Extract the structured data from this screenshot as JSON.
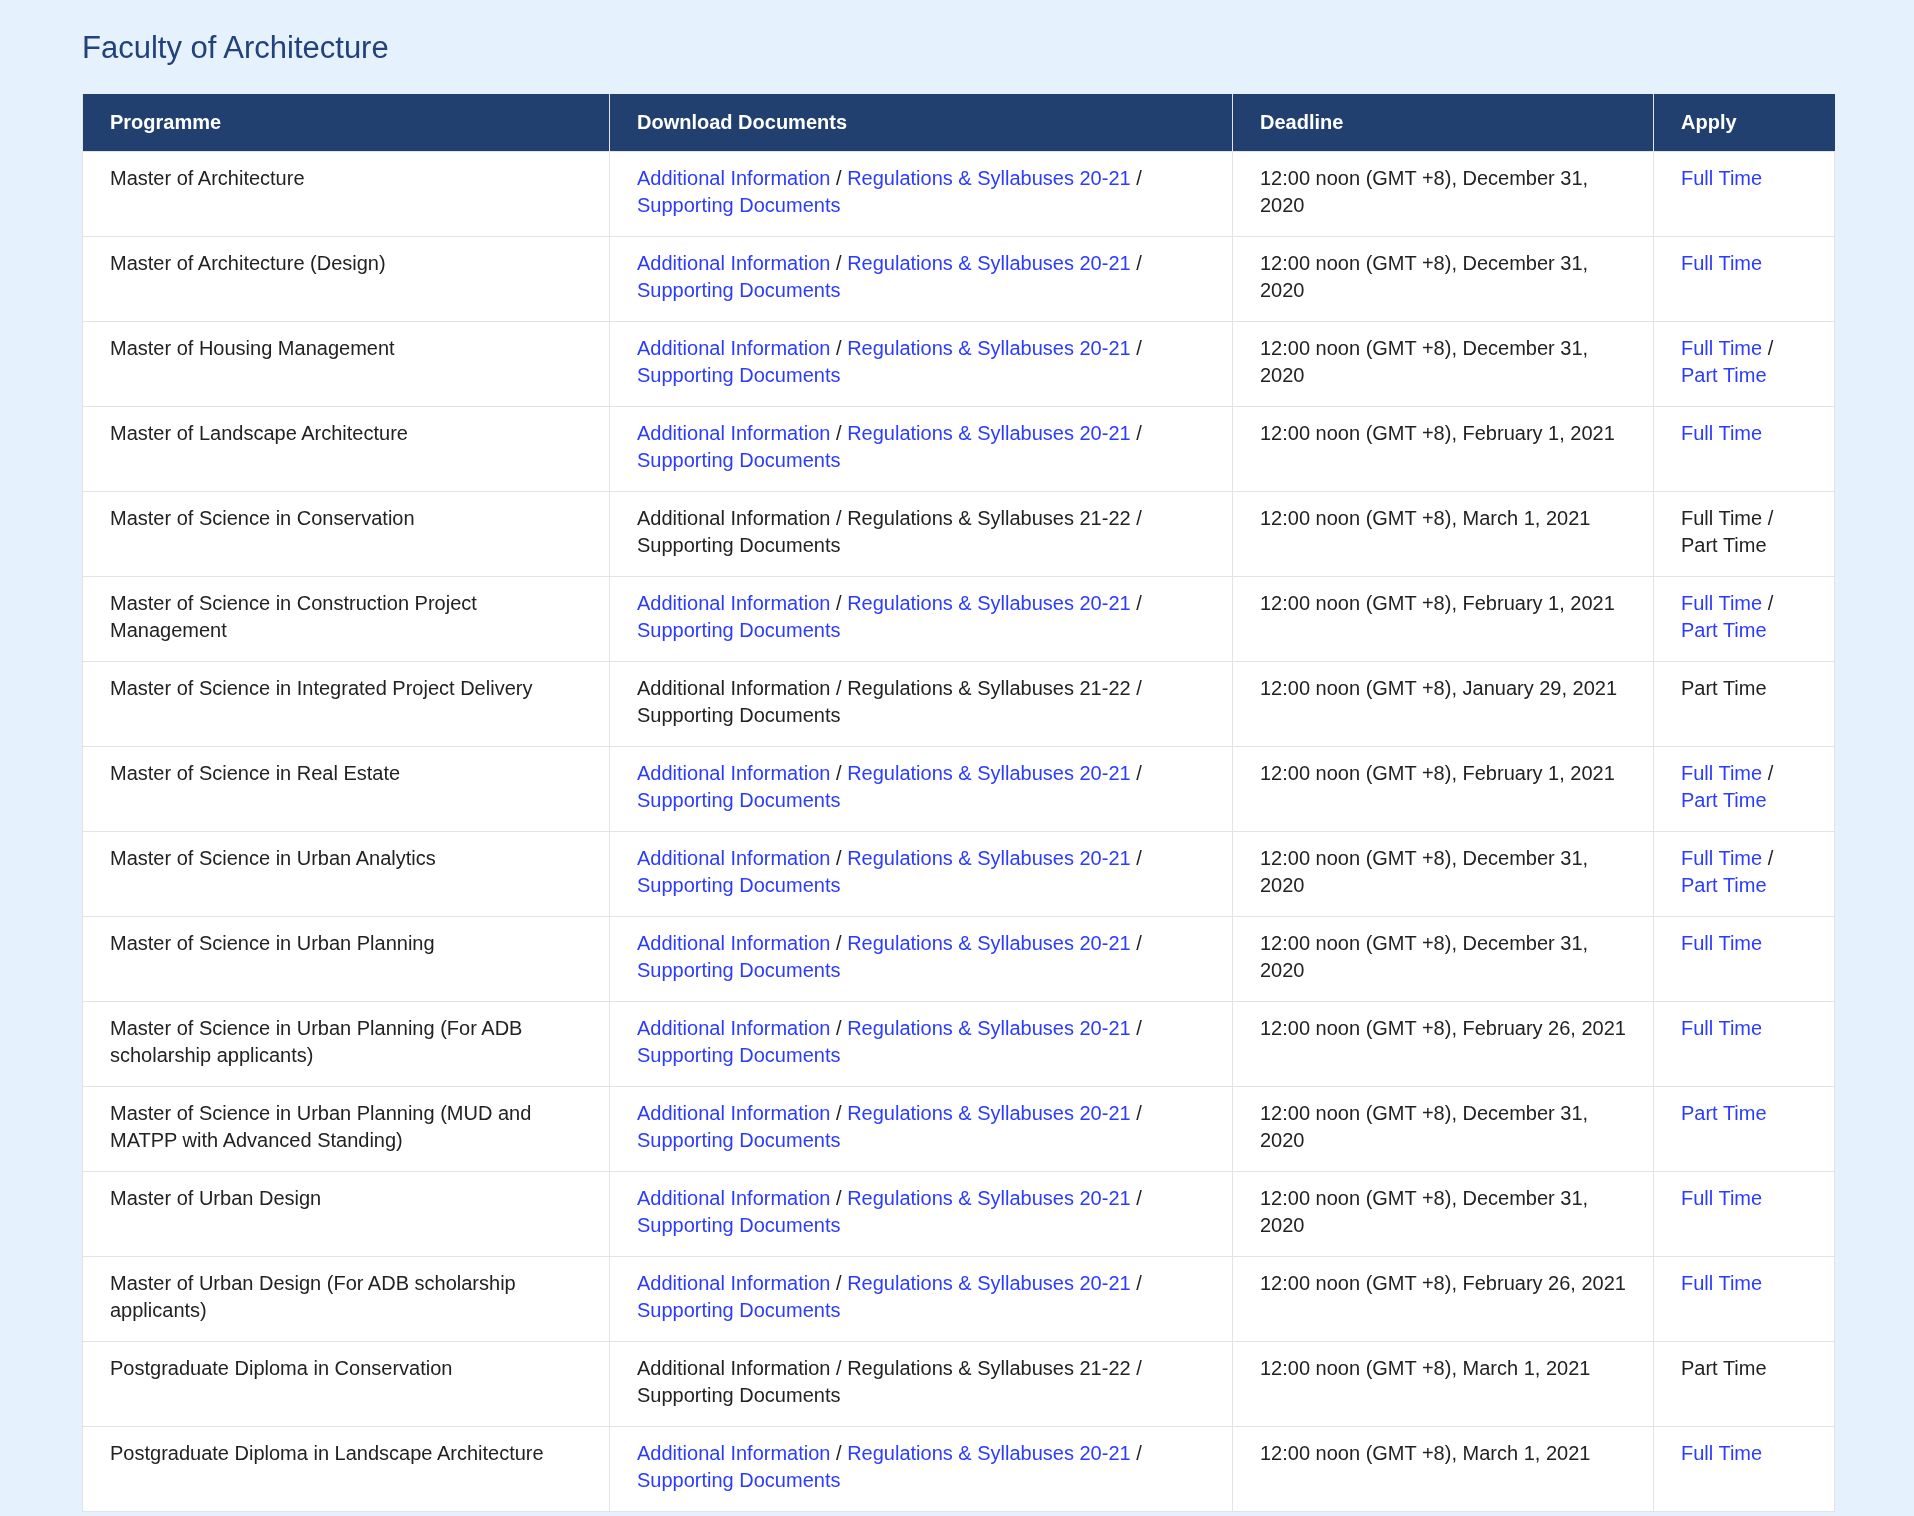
{
  "title": "Faculty of Architecture",
  "table": {
    "columns": [
      "Programme",
      "Download Documents",
      "Deadline",
      "Apply"
    ],
    "rows": [
      {
        "programme": "Master of Architecture",
        "documents": [
          {
            "text": "Additional Information",
            "link": true
          },
          {
            "text": "/",
            "link": false
          },
          {
            "text": "Regulations & Syllabuses 20-21",
            "link": true
          },
          {
            "text": "/",
            "link": false
          },
          {
            "text": "Supporting Documents",
            "link": true
          }
        ],
        "deadline": "12:00 noon (GMT +8), December 31, 2020",
        "apply": [
          {
            "text": "Full Time",
            "link": true
          }
        ]
      },
      {
        "programme": "Master of Architecture (Design)",
        "documents": [
          {
            "text": "Additional Information",
            "link": true
          },
          {
            "text": "/",
            "link": false
          },
          {
            "text": "Regulations & Syllabuses 20-21",
            "link": true
          },
          {
            "text": "/",
            "link": false
          },
          {
            "text": "Supporting Documents",
            "link": true
          }
        ],
        "deadline": "12:00 noon (GMT +8), December 31, 2020",
        "apply": [
          {
            "text": "Full Time",
            "link": true
          }
        ]
      },
      {
        "programme": "Master of Housing Management",
        "documents": [
          {
            "text": "Additional Information",
            "link": true
          },
          {
            "text": "/",
            "link": false
          },
          {
            "text": "Regulations & Syllabuses 20-21",
            "link": true
          },
          {
            "text": "/",
            "link": false
          },
          {
            "text": "Supporting Documents",
            "link": true
          }
        ],
        "deadline": "12:00 noon (GMT +8), December 31, 2020",
        "apply": [
          {
            "text": "Full Time",
            "link": true
          },
          {
            "text": "/",
            "link": false
          },
          {
            "text": "Part Time",
            "link": true
          }
        ]
      },
      {
        "programme": "Master of Landscape Architecture",
        "documents": [
          {
            "text": "Additional Information",
            "link": true
          },
          {
            "text": "/",
            "link": false
          },
          {
            "text": "Regulations & Syllabuses 20-21",
            "link": true
          },
          {
            "text": "/",
            "link": false
          },
          {
            "text": "Supporting Documents",
            "link": true
          }
        ],
        "deadline": "12:00 noon (GMT +8), February 1, 2021",
        "apply": [
          {
            "text": "Full Time",
            "link": true
          }
        ]
      },
      {
        "programme": "Master of Science in Conservation",
        "documents": [
          {
            "text": "Additional Information",
            "link": false
          },
          {
            "text": "/",
            "link": false
          },
          {
            "text": "Regulations & Syllabuses 21-22",
            "link": false
          },
          {
            "text": "/",
            "link": false
          },
          {
            "text": "Supporting Documents",
            "link": false
          }
        ],
        "deadline": "12:00 noon (GMT +8), March 1, 2021",
        "apply": [
          {
            "text": "Full Time",
            "link": false
          },
          {
            "text": "/",
            "link": false
          },
          {
            "text": "Part Time",
            "link": false
          }
        ]
      },
      {
        "programme": "Master of Science in Construction Project Management",
        "documents": [
          {
            "text": "Additional Information",
            "link": true
          },
          {
            "text": "/",
            "link": false
          },
          {
            "text": "Regulations & Syllabuses 20-21",
            "link": true
          },
          {
            "text": "/",
            "link": false
          },
          {
            "text": "Supporting Documents",
            "link": true
          }
        ],
        "deadline": "12:00 noon (GMT +8), February 1, 2021",
        "apply": [
          {
            "text": "Full Time",
            "link": true
          },
          {
            "text": "/",
            "link": false
          },
          {
            "text": "Part Time",
            "link": true
          }
        ]
      },
      {
        "programme": "Master of Science in Integrated Project Delivery",
        "documents": [
          {
            "text": "Additional Information",
            "link": false
          },
          {
            "text": "/",
            "link": false
          },
          {
            "text": "Regulations & Syllabuses 21-22",
            "link": false
          },
          {
            "text": "/",
            "link": false
          },
          {
            "text": "Supporting Documents",
            "link": false
          }
        ],
        "deadline": "12:00 noon (GMT +8), January 29, 2021",
        "apply": [
          {
            "text": "Part Time",
            "link": false
          }
        ]
      },
      {
        "programme": "Master of Science in Real Estate",
        "documents": [
          {
            "text": "Additional Information",
            "link": true
          },
          {
            "text": "/",
            "link": false
          },
          {
            "text": "Regulations & Syllabuses 20-21",
            "link": true
          },
          {
            "text": "/",
            "link": false
          },
          {
            "text": "Supporting Documents",
            "link": true
          }
        ],
        "deadline": "12:00 noon (GMT +8), February 1, 2021",
        "apply": [
          {
            "text": "Full Time",
            "link": true
          },
          {
            "text": "/",
            "link": false
          },
          {
            "text": "Part Time",
            "link": true
          }
        ]
      },
      {
        "programme": "Master of Science in Urban Analytics",
        "documents": [
          {
            "text": "Additional Information",
            "link": true
          },
          {
            "text": "/",
            "link": false
          },
          {
            "text": "Regulations & Syllabuses 20-21",
            "link": true
          },
          {
            "text": "/",
            "link": false
          },
          {
            "text": "Supporting Documents",
            "link": true
          }
        ],
        "deadline": "12:00 noon (GMT +8), December 31, 2020",
        "apply": [
          {
            "text": "Full Time",
            "link": true
          },
          {
            "text": "/",
            "link": false
          },
          {
            "text": "Part Time",
            "link": true
          }
        ]
      },
      {
        "programme": "Master of Science in Urban Planning",
        "documents": [
          {
            "text": "Additional Information",
            "link": true
          },
          {
            "text": "/",
            "link": false
          },
          {
            "text": "Regulations & Syllabuses 20-21",
            "link": true
          },
          {
            "text": "/",
            "link": false
          },
          {
            "text": "Supporting Documents",
            "link": true
          }
        ],
        "deadline": "12:00 noon (GMT +8), December 31, 2020",
        "apply": [
          {
            "text": "Full Time",
            "link": true
          }
        ]
      },
      {
        "programme": "Master of Science in Urban Planning (For ADB scholarship applicants)",
        "documents": [
          {
            "text": "Additional Information",
            "link": true
          },
          {
            "text": "/",
            "link": false
          },
          {
            "text": "Regulations & Syllabuses 20-21",
            "link": true
          },
          {
            "text": "/",
            "link": false
          },
          {
            "text": "Supporting Documents",
            "link": true
          }
        ],
        "deadline": "12:00 noon (GMT +8), February 26, 2021",
        "apply": [
          {
            "text": "Full Time",
            "link": true
          }
        ]
      },
      {
        "programme": "Master of Science in Urban Planning (MUD and MATPP with Advanced Standing)",
        "documents": [
          {
            "text": "Additional Information",
            "link": true
          },
          {
            "text": "/",
            "link": false
          },
          {
            "text": "Regulations & Syllabuses 20-21",
            "link": true
          },
          {
            "text": "/",
            "link": false
          },
          {
            "text": "Supporting Documents",
            "link": true
          }
        ],
        "deadline": "12:00 noon (GMT +8), December 31, 2020",
        "apply": [
          {
            "text": "Part Time",
            "link": true
          }
        ]
      },
      {
        "programme": "Master of Urban Design",
        "documents": [
          {
            "text": "Additional Information",
            "link": true
          },
          {
            "text": "/",
            "link": false
          },
          {
            "text": "Regulations & Syllabuses 20-21",
            "link": true
          },
          {
            "text": "/",
            "link": false
          },
          {
            "text": "Supporting Documents",
            "link": true
          }
        ],
        "deadline": "12:00 noon (GMT +8), December 31, 2020",
        "apply": [
          {
            "text": "Full Time",
            "link": true
          }
        ]
      },
      {
        "programme": "Master of Urban Design (For ADB scholarship applicants)",
        "documents": [
          {
            "text": "Additional Information",
            "link": true
          },
          {
            "text": "/",
            "link": false
          },
          {
            "text": "Regulations & Syllabuses 20-21",
            "link": true
          },
          {
            "text": "/",
            "link": false
          },
          {
            "text": "Supporting Documents",
            "link": true
          }
        ],
        "deadline": "12:00 noon (GMT +8), February 26, 2021",
        "apply": [
          {
            "text": "Full Time",
            "link": true
          }
        ]
      },
      {
        "programme": "Postgraduate Diploma in Conservation",
        "documents": [
          {
            "text": "Additional Information",
            "link": false
          },
          {
            "text": "/",
            "link": false
          },
          {
            "text": "Regulations & Syllabuses 21-22",
            "link": false
          },
          {
            "text": "/",
            "link": false
          },
          {
            "text": "Supporting Documents",
            "link": false
          }
        ],
        "deadline": "12:00 noon (GMT +8), March 1, 2021",
        "apply": [
          {
            "text": "Part Time",
            "link": false
          }
        ]
      },
      {
        "programme": "Postgraduate Diploma in Landscape Architecture",
        "documents": [
          {
            "text": "Additional Information",
            "link": true
          },
          {
            "text": "/",
            "link": false
          },
          {
            "text": "Regulations & Syllabuses 20-21",
            "link": true
          },
          {
            "text": "/",
            "link": false
          },
          {
            "text": "Supporting Documents",
            "link": true
          }
        ],
        "deadline": "12:00 noon (GMT +8), March 1, 2021",
        "apply": [
          {
            "text": "Full Time",
            "link": true
          }
        ]
      }
    ]
  }
}
